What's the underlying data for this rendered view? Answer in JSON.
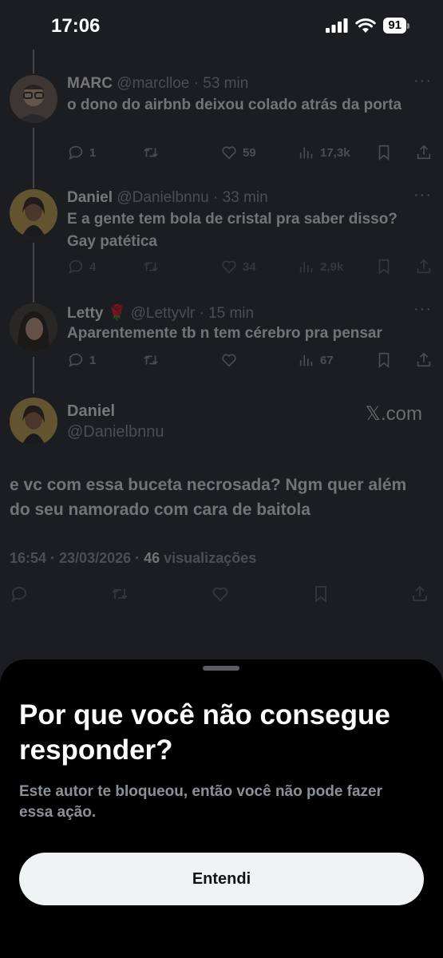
{
  "status_bar": {
    "time": "17:06",
    "battery": "91"
  },
  "tweets": [
    {
      "name": "MARC",
      "handle": "@marclloe",
      "sep": "·",
      "time": "53 min",
      "text": "o dono do airbnb deixou colado atrás da porta",
      "replies": "1",
      "likes": "59",
      "views": "17,3k"
    },
    {
      "name": "Daniel",
      "handle": "@Danielbnnu",
      "sep": "·",
      "time": "33 min",
      "text": "E a gente tem bola de cristal pra saber disso? Gay patética",
      "replies": "4",
      "likes": "34",
      "views": "2,9k"
    },
    {
      "name": "Letty",
      "name_emoji": "🌹",
      "handle": "@Lettyvlr",
      "sep": "·",
      "time": "15 min",
      "text": "Aparentemente tb n tem cérebro pra pensar",
      "replies": "1",
      "likes": "",
      "views": "67"
    }
  ],
  "main_tweet": {
    "name": "Daniel",
    "handle": "@Danielbnnu",
    "watermark": "𝕏.com",
    "text": "e vc com essa buceta necrosada? Ngm quer além do seu namorado com cara de baitola",
    "timestamp": "16:54 · 23/03/2026 · ",
    "views_count": "46",
    "views_label": " visualizações"
  },
  "sheet": {
    "title": "Por que você não consegue responder?",
    "body": "Este autor te bloqueou, então você não pode fazer essa ação.",
    "button_label": "Entendi"
  },
  "colors": {
    "background": "#1c1d20",
    "sheet": "#000000",
    "button": "#eff3f4",
    "muted_text": "#8b9097"
  }
}
